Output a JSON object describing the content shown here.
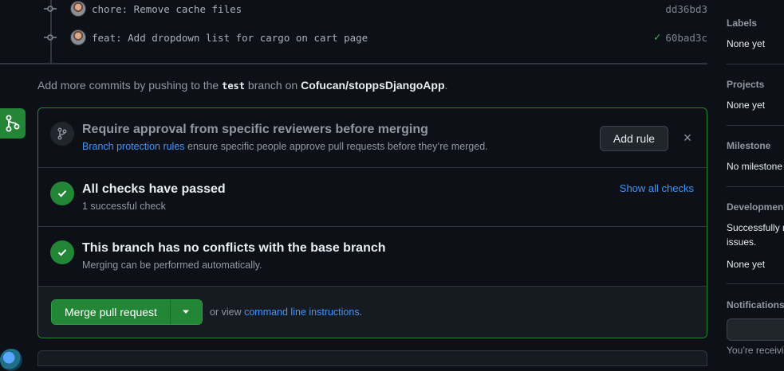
{
  "commits": [
    {
      "message": "chore: Remove cache files",
      "sha": "dd36bd3",
      "check": false
    },
    {
      "message": "feat: Add dropdown list for cargo on cart page",
      "sha": "60bad3c",
      "check": true
    }
  ],
  "push_note": {
    "prefix": "Add more commits by pushing to the ",
    "branch": "test",
    "middle": " branch on ",
    "repo": "Cofucan/stoppsDjangoApp",
    "suffix": "."
  },
  "protection": {
    "title": "Require approval from specific reviewers before merging",
    "link": "Branch protection rules",
    "desc": " ensure specific people approve pull requests before they’re merged.",
    "add_rule": "Add rule",
    "dismiss": "×"
  },
  "checks": {
    "title": "All checks have passed",
    "sub": "1 successful check",
    "show_all": "Show all checks"
  },
  "conflicts": {
    "title": "This branch has no conflicts with the base branch",
    "sub": "Merging can be performed automatically."
  },
  "merge": {
    "button": "Merge pull request",
    "or_view": "or view ",
    "cli_link": "command line instructions",
    "suffix": "."
  },
  "sidebar": {
    "labels": {
      "heading": "Labels",
      "value": "None yet"
    },
    "projects": {
      "heading": "Projects",
      "value": "None yet"
    },
    "milestone": {
      "heading": "Milestone",
      "value": "No milestone"
    },
    "development": {
      "heading": "Development",
      "line1": "Successfully r",
      "line2": "issues.",
      "value": "None yet"
    },
    "notifications": {
      "heading": "Notifications",
      "receiving": "You’re receivin"
    }
  },
  "colors": {
    "accent_green": "#238636",
    "link_blue": "#4493f8",
    "bg": "#0d1117"
  }
}
